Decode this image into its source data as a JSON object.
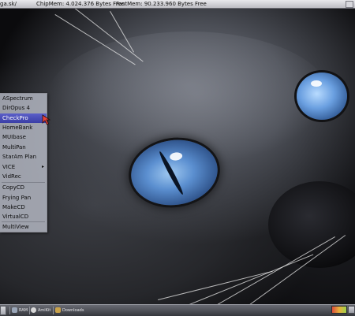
{
  "topbar": {
    "title": "ga.sk/",
    "chipmem": "ChipMem: 4.024.376 Bytes Free",
    "fastmem": "FastMem: 90.233.960 Bytes Free"
  },
  "start_menu": {
    "items": [
      {
        "label": "ASpectrum",
        "active": false,
        "submenu": false
      },
      {
        "label": "DirOpus 4",
        "active": false,
        "submenu": false
      },
      {
        "label": "CheckPro",
        "active": true,
        "submenu": false
      },
      {
        "label": "HomeBank",
        "active": false,
        "submenu": false
      },
      {
        "label": "MUIbase",
        "active": false,
        "submenu": false
      },
      {
        "label": "MultiPan",
        "active": false,
        "submenu": false
      },
      {
        "label": "StarAm Plan",
        "active": false,
        "submenu": false
      },
      {
        "label": "VICE",
        "active": false,
        "submenu": true
      },
      {
        "label": "VidRec",
        "active": false,
        "submenu": false
      },
      {
        "label": "CopyCD",
        "active": false,
        "submenu": false
      },
      {
        "label": "Frying Pan",
        "active": false,
        "submenu": false
      },
      {
        "label": "MakeCD",
        "active": false,
        "submenu": false
      },
      {
        "label": "VirtualCD",
        "active": false,
        "submenu": false
      },
      {
        "label": "MultiView",
        "active": false,
        "submenu": false
      }
    ],
    "submenu_arrow": "▸"
  },
  "taskbar": {
    "tasks": [
      {
        "label": "RAM",
        "icon": "drive-icon",
        "color": "#9aa6b8"
      },
      {
        "label": "AmiKit",
        "icon": "amikit-icon",
        "color": "#d8d8d8"
      },
      {
        "label": "Downloads",
        "icon": "folder-icon",
        "color": "#c9a24a"
      }
    ]
  },
  "colors": {
    "menu_highlight": "#4448b4",
    "eye_blue": "#5b8fd0"
  }
}
